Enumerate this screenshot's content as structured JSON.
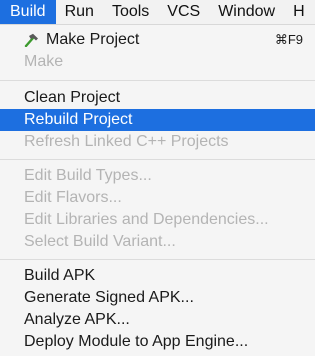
{
  "menubar": {
    "items": [
      "Build",
      "Run",
      "Tools",
      "VCS",
      "Window",
      "H"
    ],
    "active": "Build"
  },
  "build_menu": {
    "make_project": {
      "label": "Make Project",
      "shortcut": "⌘F9",
      "icon": "hammer-icon"
    },
    "make": {
      "label": "Make"
    },
    "clean_project": {
      "label": "Clean Project"
    },
    "rebuild_project": {
      "label": "Rebuild Project"
    },
    "refresh_linked": {
      "label": "Refresh Linked C++ Projects"
    },
    "edit_build_types": {
      "label": "Edit Build Types..."
    },
    "edit_flavors": {
      "label": "Edit Flavors..."
    },
    "edit_libraries": {
      "label": "Edit Libraries and Dependencies..."
    },
    "select_build_variant": {
      "label": "Select Build Variant..."
    },
    "build_apk": {
      "label": "Build APK"
    },
    "generate_signed_apk": {
      "label": "Generate Signed APK..."
    },
    "analyze_apk": {
      "label": "Analyze APK..."
    },
    "deploy_module": {
      "label": "Deploy Module to App Engine..."
    }
  },
  "colors": {
    "selection": "#1d6fe0",
    "menu_background": "#f5f5f5",
    "disabled_text": "#b4b4b4",
    "hammer_handle": "#3c9a2e",
    "hammer_head": "#5a5a5a"
  }
}
